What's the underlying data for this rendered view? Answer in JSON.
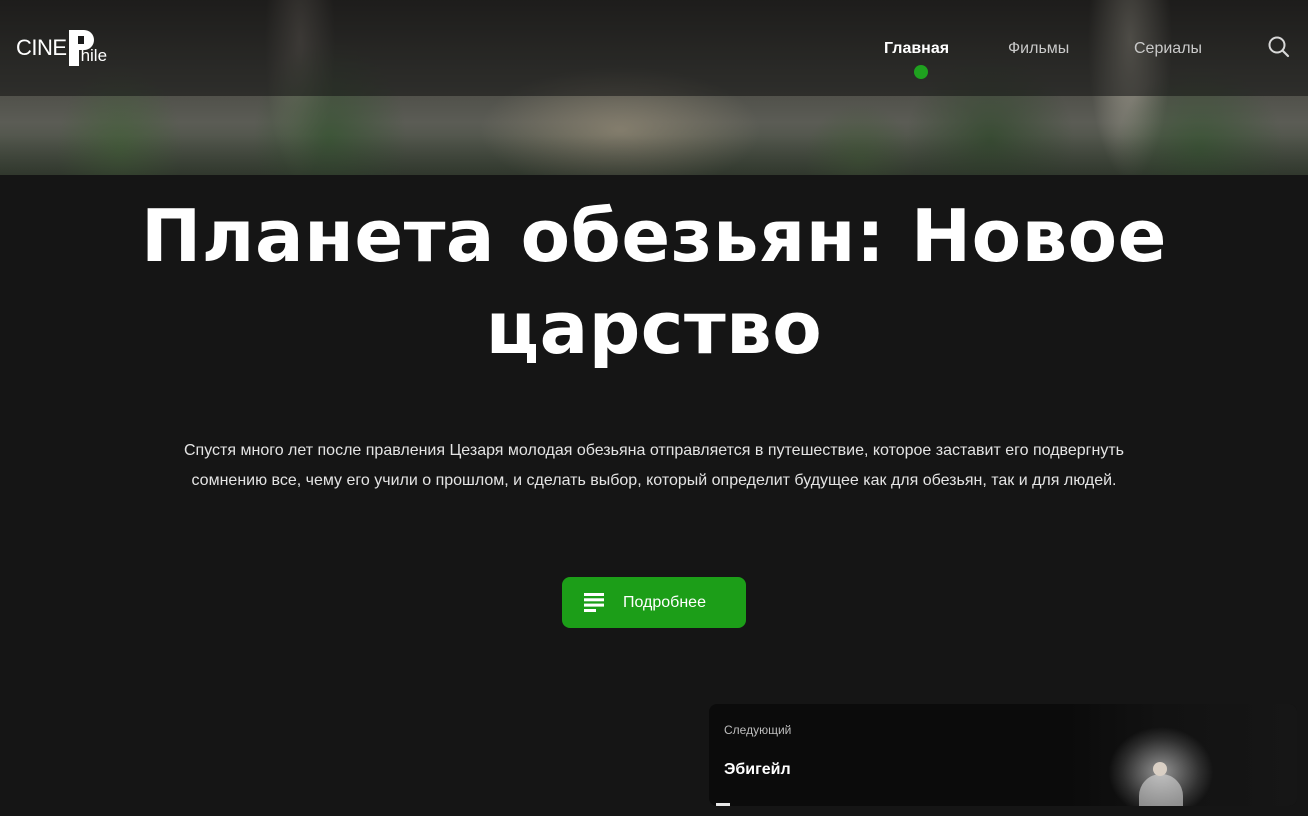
{
  "brand": {
    "logo_prefix": "CINE",
    "logo_suffix": "hile"
  },
  "nav": {
    "items": [
      {
        "label": "Главная",
        "active": true
      },
      {
        "label": "Фильмы",
        "active": false
      },
      {
        "label": "Сериалы",
        "active": false
      }
    ],
    "search_icon": "search-icon"
  },
  "hero": {
    "title": "Планета обезьян: Новое царство",
    "description": "Спустя много лет после правления Цезаря молодая обезьяна отправляется в путешествие, которое заставит его подвергнуть сомнению все, чему его учили о прошлом, и сделать выбор, который определит будущее как для обезьян, так и для людей.",
    "details_button": {
      "label": "Подробнее",
      "icon": "list-icon"
    }
  },
  "next_card": {
    "label": "Следующий",
    "title": "Эбигейл"
  },
  "colors": {
    "accent": "#1fa11f",
    "background": "#151515",
    "card_background": "#0b0b0b"
  }
}
